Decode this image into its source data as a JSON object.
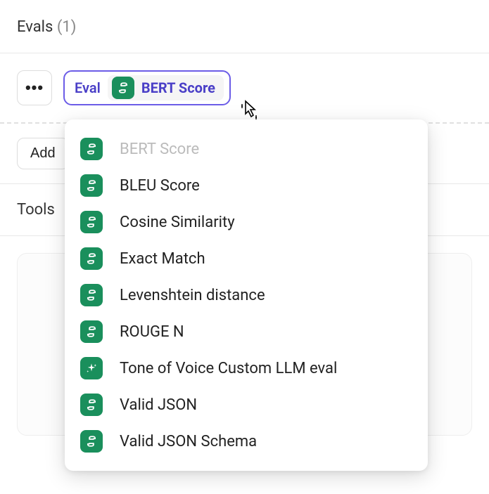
{
  "header": {
    "title": "Evals",
    "count": "(1)"
  },
  "toolbar": {
    "chip_prefix": "Eval",
    "chip_selected": "BERT Score"
  },
  "add_button": "Add",
  "tools_header": "Tools",
  "dropdown": {
    "items": [
      {
        "label": "BERT Score",
        "icon": "python",
        "selected": true
      },
      {
        "label": "BLEU Score",
        "icon": "python",
        "selected": false
      },
      {
        "label": "Cosine Similarity",
        "icon": "python",
        "selected": false
      },
      {
        "label": "Exact Match",
        "icon": "python",
        "selected": false
      },
      {
        "label": "Levenshtein distance",
        "icon": "python",
        "selected": false
      },
      {
        "label": "ROUGE N",
        "icon": "python",
        "selected": false
      },
      {
        "label": "Tone of Voice Custom LLM eval",
        "icon": "sparkle",
        "selected": false
      },
      {
        "label": "Valid JSON",
        "icon": "python",
        "selected": false
      },
      {
        "label": "Valid JSON Schema",
        "icon": "python",
        "selected": false
      }
    ]
  }
}
